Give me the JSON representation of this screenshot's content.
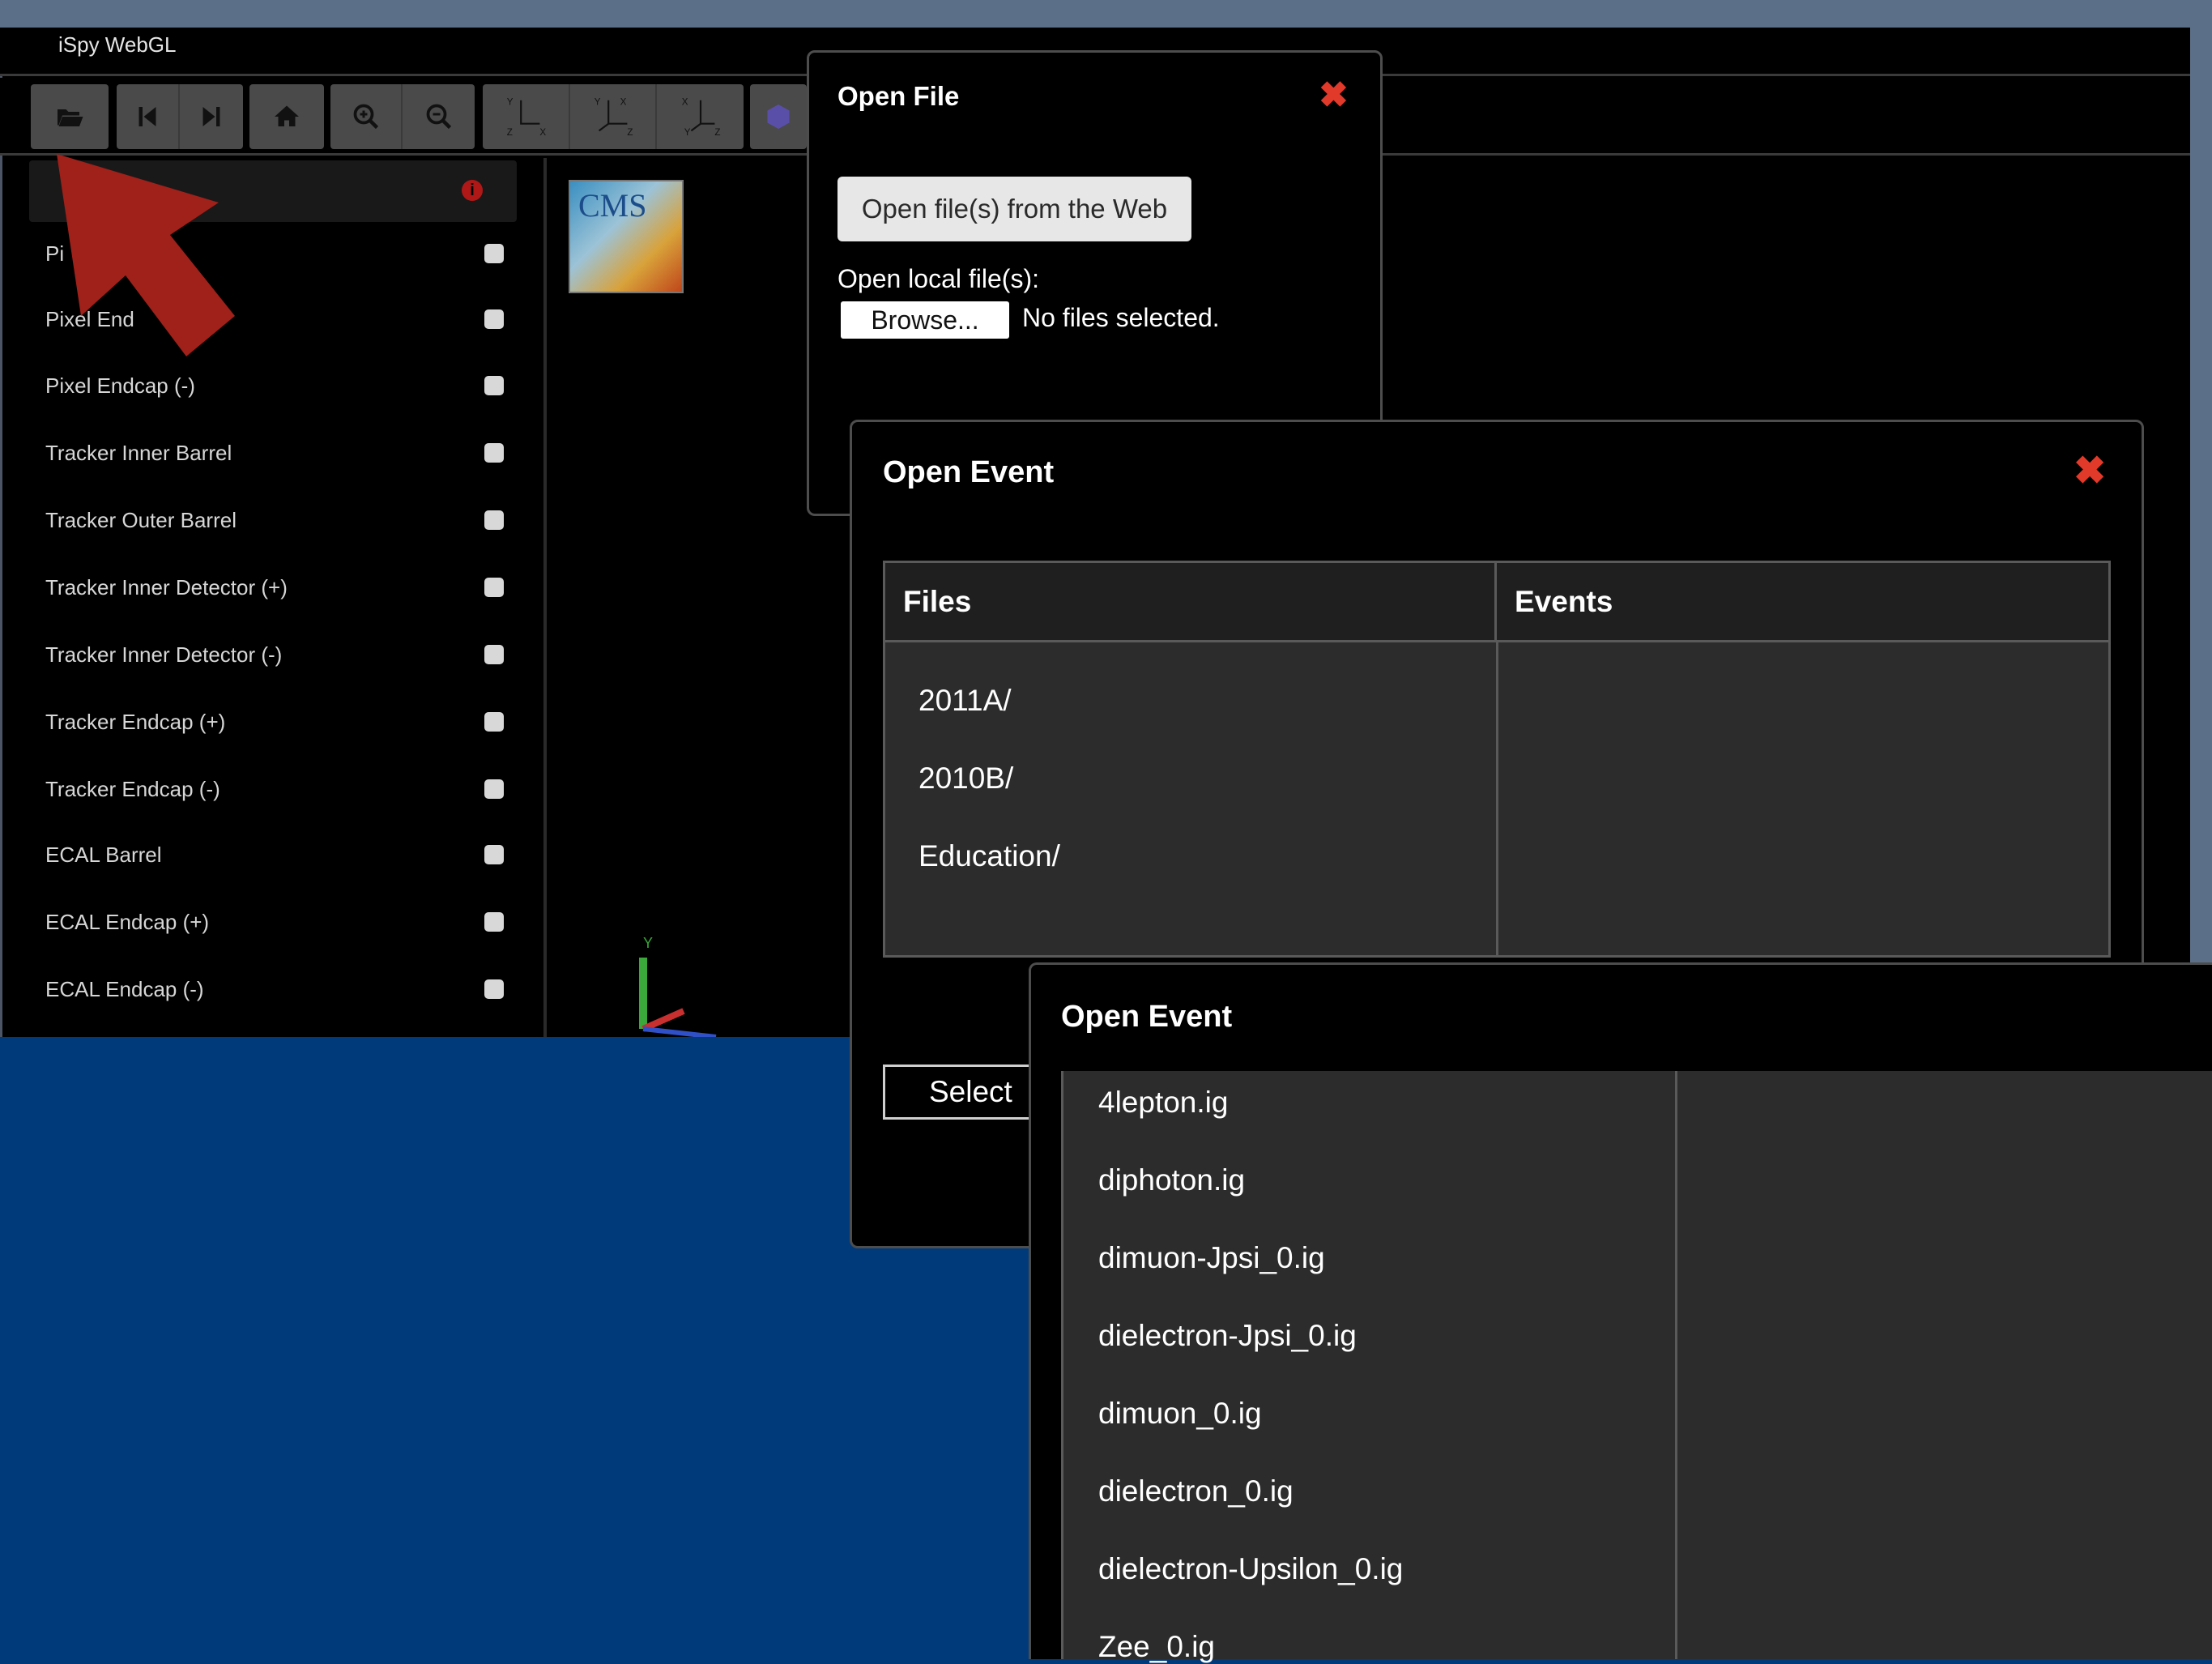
{
  "app": {
    "title": "iSpy WebGL"
  },
  "toolbar": {
    "buttons": [
      "folder-open-icon",
      "step-backward-icon",
      "step-forward-icon",
      "home-icon",
      "zoom-in-icon",
      "zoom-out-icon",
      "axes-yx-icon",
      "axes-xyz-icon",
      "axes-xy-icon",
      "cube-icon"
    ]
  },
  "sidebar": {
    "items": [
      {
        "label": "Pi"
      },
      {
        "label": "Pixel End"
      },
      {
        "label": "Pixel Endcap (-)"
      },
      {
        "label": "Tracker Inner Barrel"
      },
      {
        "label": "Tracker Outer Barrel"
      },
      {
        "label": "Tracker Inner Detector (+)"
      },
      {
        "label": "Tracker Inner Detector (-)"
      },
      {
        "label": "Tracker Endcap (+)"
      },
      {
        "label": "Tracker Endcap (-)"
      },
      {
        "label": "ECAL Barrel"
      },
      {
        "label": "ECAL Endcap (+)"
      },
      {
        "label": "ECAL Endcap (-)"
      }
    ]
  },
  "viewport": {
    "logo_text": "CMS"
  },
  "open_file_dialog": {
    "title": "Open File",
    "web_button": "Open file(s) from the Web",
    "local_label": "Open local file(s):",
    "browse_button": "Browse...",
    "no_files": "No files selected."
  },
  "open_event_dialog_1": {
    "title": "Open Event",
    "columns": [
      "Files",
      "Events"
    ],
    "files": [
      "2011A/",
      "2010B/",
      "Education/"
    ],
    "select_button": "Select"
  },
  "open_event_dialog_2": {
    "title": "Open Event",
    "files": [
      "4lepton.ig",
      "diphoton.ig",
      "dimuon-Jpsi_0.ig",
      "dielectron-Jpsi_0.ig",
      "dimuon_0.ig",
      "dielectron_0.ig",
      "dielectron-Upsilon_0.ig",
      "Zee_0.ig"
    ]
  },
  "colors": {
    "close_icon": "#e13a2a",
    "background": "#003a7a",
    "annotation_arrow": "#a0201a"
  }
}
